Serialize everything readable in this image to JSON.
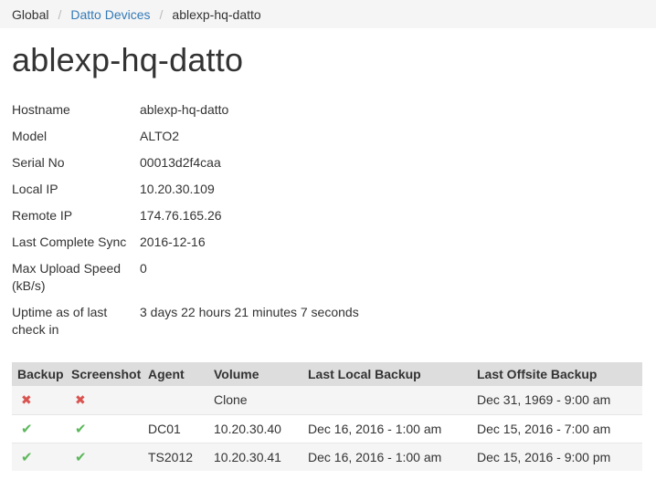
{
  "breadcrumb": {
    "items": [
      {
        "label": "Global",
        "link": false
      },
      {
        "label": "Datto Devices",
        "link": true
      },
      {
        "label": "ablexp-hq-datto",
        "link": false
      }
    ],
    "separator": "/"
  },
  "page_title": "ablexp-hq-datto",
  "details": [
    {
      "label": "Hostname",
      "value": "ablexp-hq-datto"
    },
    {
      "label": "Model",
      "value": "ALTO2"
    },
    {
      "label": "Serial No",
      "value": "00013d2f4caa"
    },
    {
      "label": "Local IP",
      "value": "10.20.30.109"
    },
    {
      "label": "Remote IP",
      "value": "174.76.165.26"
    },
    {
      "label": "Last Complete Sync",
      "value": "2016-12-16"
    },
    {
      "label": "Max Upload Speed (kB/s)",
      "value": "0"
    },
    {
      "label": "Uptime as of last check in",
      "value": "3 days 22 hours 21 minutes 7 seconds"
    }
  ],
  "table": {
    "columns": [
      "Backup",
      "Screenshot",
      "Agent",
      "Volume",
      "Last Local Backup",
      "Last Offsite Backup"
    ],
    "rows": [
      {
        "backup_icon": "x-icon",
        "screenshot_icon": "x-icon",
        "agent": "",
        "volume": "Clone",
        "last_local": "",
        "last_offsite": "Dec 31, 1969 - 9:00 am"
      },
      {
        "backup_icon": "check-icon",
        "screenshot_icon": "check-icon",
        "agent": "DC01",
        "volume": "10.20.30.40",
        "last_local": "Dec 16, 2016 - 1:00 am",
        "last_offsite": "Dec 15, 2016 - 7:00 am"
      },
      {
        "backup_icon": "check-icon",
        "screenshot_icon": "check-icon",
        "agent": "TS2012",
        "volume": "10.20.30.41",
        "last_local": "Dec 16, 2016 - 1:00 am",
        "last_offsite": "Dec 15, 2016 - 9:00 pm"
      }
    ]
  },
  "colors": {
    "link": "#337ab7",
    "error": "#d9534f",
    "success": "#5cb85c",
    "header_bg": "#dddddd"
  }
}
